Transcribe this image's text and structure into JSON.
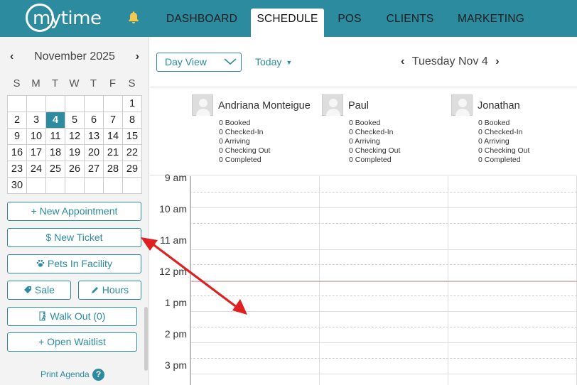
{
  "app": {
    "logo_text": "mytime"
  },
  "icons": {
    "bell": "bell-icon",
    "paw": "paw-icon",
    "tag": "tag-icon",
    "pencil": "pencil-icon",
    "walk": "walking-person-icon",
    "help": "question-icon"
  },
  "nav": {
    "tabs": [
      {
        "label": "DASHBOARD"
      },
      {
        "label": "SCHEDULE",
        "active": true
      },
      {
        "label": "POS"
      },
      {
        "label": "CLIENTS"
      },
      {
        "label": "MARKETING"
      }
    ]
  },
  "calendar": {
    "month_label": "November 2025",
    "prev": "‹",
    "next": "›",
    "weekdays": [
      "S",
      "M",
      "T",
      "W",
      "T",
      "F",
      "S"
    ],
    "weeks": [
      [
        "",
        "",
        "",
        "",
        "",
        "",
        "1"
      ],
      [
        "2",
        "3",
        "4",
        "5",
        "6",
        "7",
        "8"
      ],
      [
        "9",
        "10",
        "11",
        "12",
        "13",
        "14",
        "15"
      ],
      [
        "16",
        "17",
        "18",
        "19",
        "20",
        "21",
        "22"
      ],
      [
        "23",
        "24",
        "25",
        "26",
        "27",
        "28",
        "29"
      ],
      [
        "30",
        "",
        "",
        "",
        "",
        "",
        ""
      ]
    ],
    "selected_day": "4"
  },
  "sidebar": {
    "new_appointment": "+ New Appointment",
    "new_ticket": "$  New Ticket",
    "pets_in_facility": "Pets In Facility",
    "sale": "Sale",
    "hours": "Hours",
    "walk_out": "Walk Out (0)",
    "open_waitlist": "+ Open Waitlist",
    "print_agenda": "Print Agenda",
    "help": "?"
  },
  "toolbar": {
    "view": "Day View",
    "today": "Today",
    "date": "Tuesday Nov 4"
  },
  "staff": [
    {
      "name": "Andriana Monteigue",
      "stats": [
        "0 Booked",
        "0 Checked-In",
        "0 Arriving",
        "0 Checking Out",
        "0 Completed"
      ]
    },
    {
      "name": "Paul",
      "stats": [
        "0 Booked",
        "0 Checked-In",
        "0 Arriving",
        "0 Checking Out",
        "0 Completed"
      ]
    },
    {
      "name": "Jonathan",
      "stats": [
        "0 Booked",
        "0 Checked-In",
        "0 Arriving",
        "0 Checking Out",
        "0 Completed"
      ]
    }
  ],
  "times": [
    "9 am",
    "10 am",
    "11 am",
    "12 pm",
    "1 pm",
    "2 pm",
    "3 pm"
  ],
  "colors": {
    "brand": "#2c8b9e",
    "annotation_arrow": "#e02020",
    "now_line": "#e8a3ad"
  }
}
